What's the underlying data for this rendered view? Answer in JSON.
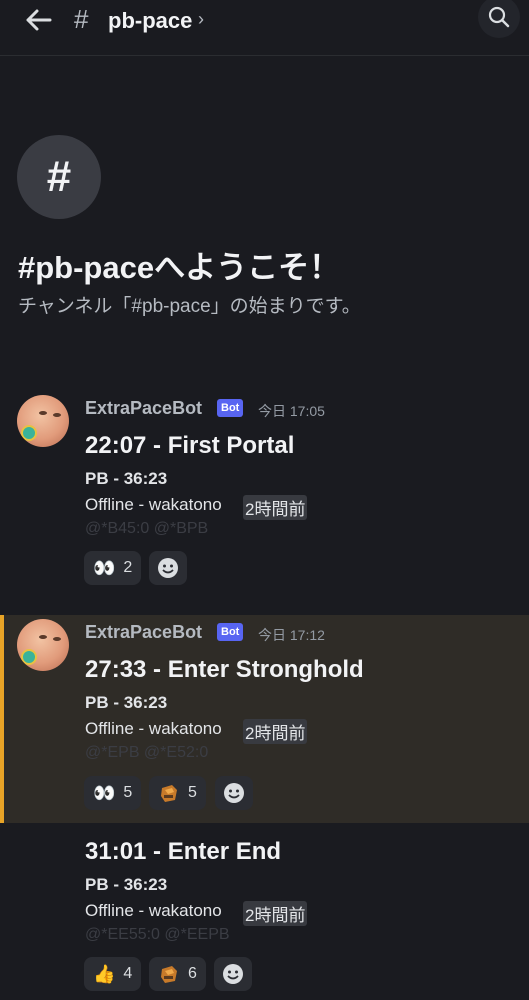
{
  "header": {
    "hash_symbol": "#",
    "channel_name": "pb-pace",
    "chevron": "›",
    "back_icon": "arrow-left-icon",
    "search_icon": "search-icon"
  },
  "welcome": {
    "icon_symbol": "#",
    "title": "#pb-paceへようこそ！",
    "subtitle": "チャンネル「#pb-pace」の始まりです。"
  },
  "messages": [
    {
      "username": "ExtraPaceBot",
      "bot_label": "Bot",
      "timestamp": "今日 17:05",
      "title": "22:07 - First Portal",
      "pb": "PB - 36:23",
      "offline": "Offline - wakatono",
      "relative_time": "2時間前",
      "mentions": "@*B45:0 @*BPB",
      "reactions": [
        {
          "emoji": "eyes-emoji",
          "glyph": "👀",
          "count": "2"
        }
      ]
    },
    {
      "username": "ExtraPaceBot",
      "bot_label": "Bot",
      "timestamp": "今日 17:12",
      "title": "27:33 - Enter Stronghold",
      "pb": "PB - 36:23",
      "offline": "Offline - wakatono",
      "relative_time": "2時間前",
      "mentions": "@*EPB @*E52:0",
      "reactions": [
        {
          "emoji": "eyes-emoji",
          "glyph": "👀",
          "count": "5"
        },
        {
          "emoji": "custom-block-emoji",
          "glyph": "",
          "count": "5"
        }
      ]
    },
    {
      "title": "31:01 - Enter End",
      "pb": "PB - 36:23",
      "offline": "Offline - wakatono",
      "relative_time": "2時間前",
      "mentions": "@*EE55:0 @*EEPB",
      "reactions": [
        {
          "emoji": "thumbs-up-emoji",
          "glyph": "👍",
          "count": "4"
        },
        {
          "emoji": "custom-block-emoji",
          "glyph": "",
          "count": "6"
        }
      ]
    }
  ],
  "colors": {
    "background": "#1a1b20",
    "highlight": "#2f2c27",
    "highlight_bar": "#e8a427",
    "bot_badge": "#5865f2"
  }
}
